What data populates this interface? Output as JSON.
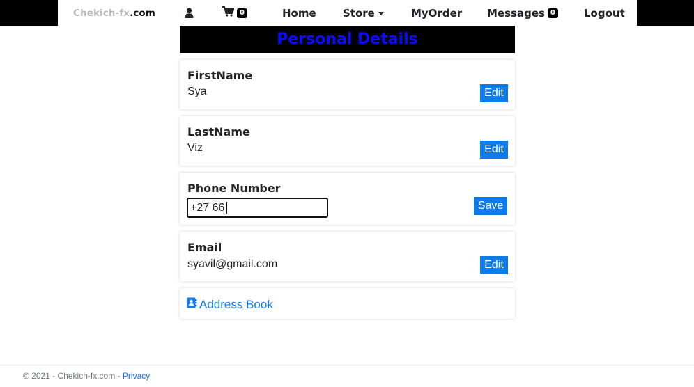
{
  "nav": {
    "brand_part1": "Chekich-fx",
    "brand_part2": ".com",
    "cart_count": "0",
    "home": "Home",
    "store": "Store",
    "myorder": "MyOrder",
    "messages": "Messages",
    "messages_count": "0",
    "logout": "Logout"
  },
  "header": {
    "title": "Personal Details"
  },
  "fields": {
    "first_name": {
      "label": "FirstName",
      "value": "Sya",
      "button": "Edit"
    },
    "last_name": {
      "label": "LastName",
      "value": "Viz",
      "button": "Edit"
    },
    "phone": {
      "label": "Phone Number",
      "value": "+27 66",
      "button": "Save"
    },
    "email": {
      "label": "Email",
      "value": "syavil@gmail.com",
      "button": "Edit"
    }
  },
  "address_book": {
    "label": "Address Book",
    "icon": "address-book-icon"
  },
  "footer": {
    "text": "© 2021 - Chekich-fx.com -",
    "privacy": "Privacy"
  },
  "colors": {
    "nav_bg": "#000000",
    "header_bg": "#000000",
    "header_text": "#0b0bff",
    "button": "#0d7bea",
    "link": "#0d7bea"
  }
}
